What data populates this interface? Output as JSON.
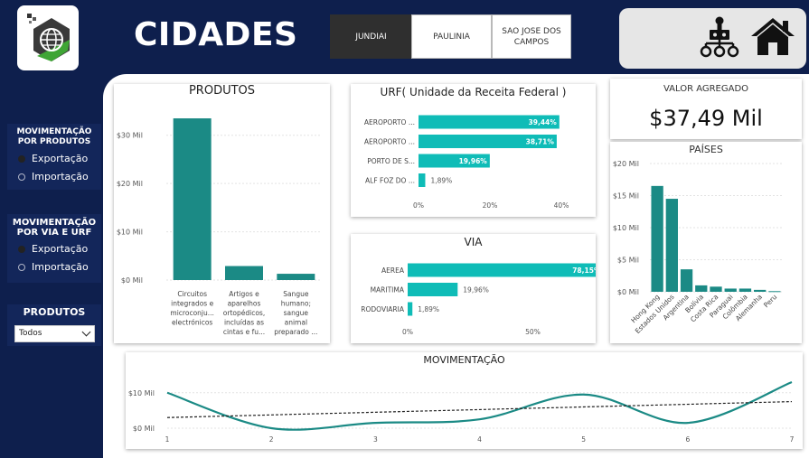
{
  "header": {
    "title": "CIDADES",
    "cities": [
      "JUNDIAI",
      "PAULINIA",
      "SAO JOSE DOS CAMPOS"
    ],
    "selected_city": "JUNDIAI"
  },
  "sidebar": {
    "group1": {
      "title": "MOVIMENTAÇÃO POR PRODUTOS",
      "options": [
        "Exportação",
        "Importação"
      ],
      "selected": "Exportação"
    },
    "group2": {
      "title": "MOVIMENTAÇÃO POR VIA E URF",
      "options": [
        "Exportação",
        "Importação"
      ],
      "selected": "Exportação"
    },
    "products_filter": {
      "title": "PRODUTOS",
      "value": "Todos"
    }
  },
  "kpi": {
    "title": "VALOR AGREGADO",
    "value": "$37,49 Mil"
  },
  "colors": {
    "teal_dark": "#1b8a85",
    "teal_light": "#0fbcb7",
    "navy": "#0e1f4d"
  },
  "chart_data": [
    {
      "id": "produtos",
      "type": "bar",
      "title": "PRODUTOS",
      "categories": [
        [
          "Circuitos",
          "integrados e",
          "microconju...",
          "electrónicos"
        ],
        [
          "Artigos e",
          "aparelhos",
          "ortopédicos,",
          "incluídas as",
          "cintas e fu..."
        ],
        [
          "Sangue",
          "humano;",
          "sangue",
          "animal",
          "preparado ..."
        ]
      ],
      "values": [
        33.5,
        2.9,
        1.3
      ],
      "yticks": [
        "$0 Mil",
        "$10 Mil",
        "$20 Mil",
        "$30 Mil"
      ],
      "ylim": [
        0,
        35
      ]
    },
    {
      "id": "urf",
      "type": "bar",
      "orientation": "horizontal",
      "title": "URF( Unidade da Receita Federal )",
      "categories": [
        "AEROPORTO ...",
        "AEROPORTO ...",
        "PORTO DE S...",
        "ALF FOZ DO ..."
      ],
      "values": [
        39.44,
        38.71,
        19.96,
        1.89
      ],
      "labels": [
        "39,44%",
        "38,71%",
        "19,96%",
        "1,89%"
      ],
      "xticks": [
        "0%",
        "20%",
        "40%"
      ],
      "xlim": [
        0,
        40
      ]
    },
    {
      "id": "via",
      "type": "bar",
      "orientation": "horizontal",
      "title": "VIA",
      "categories": [
        "AEREA",
        "MARITIMA",
        "RODOVIARIA"
      ],
      "values": [
        78.15,
        19.96,
        1.89
      ],
      "labels": [
        "78,15%",
        "19,96%",
        "1,89%"
      ],
      "xticks": [
        "0%",
        "50%"
      ],
      "xlim": [
        0,
        100
      ]
    },
    {
      "id": "paises",
      "type": "bar",
      "title": "PAÍSES",
      "categories": [
        "Hong Kong",
        "Estados Unidos",
        "Argentina",
        "Bolívia",
        "Costa Rica",
        "Paraguai",
        "Colômbia",
        "Alemanha",
        "Peru"
      ],
      "values": [
        16.5,
        14.5,
        3.5,
        1.0,
        0.8,
        0.5,
        0.5,
        0.3,
        0.1
      ],
      "yticks": [
        "$0 Mil",
        "$5 Mil",
        "$10 Mil",
        "$15 Mil",
        "$20 Mil"
      ],
      "ylim": [
        0,
        20
      ]
    },
    {
      "id": "movimentacao",
      "type": "line",
      "title": "MOVIMENTAÇÃO",
      "x": [
        1,
        2,
        3,
        4,
        5,
        6,
        7
      ],
      "values": [
        10.0,
        0.0,
        1.5,
        2.5,
        9.5,
        1.5,
        13.0
      ],
      "trend": [
        3.0,
        7.5
      ],
      "xticks": [
        "1",
        "2",
        "3",
        "4",
        "5",
        "6",
        "7"
      ],
      "yticks": [
        "$0 Mil",
        "$10 Mil"
      ],
      "ylim": [
        0,
        13
      ]
    }
  ]
}
